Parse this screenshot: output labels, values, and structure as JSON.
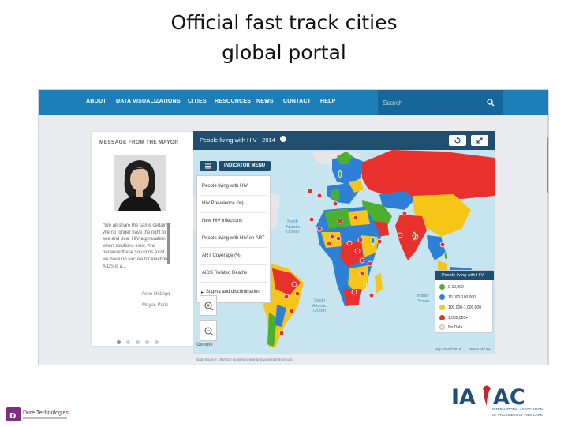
{
  "slide": {
    "title_line1": "Official fast track cities",
    "title_line2": "global portal"
  },
  "nav": {
    "items": [
      "ABOUT",
      "DATA VISUALIZATIONS",
      "CITIES",
      "RESOURCES",
      "NEWS",
      "CONTACT",
      "HELP"
    ],
    "search_placeholder": "Search"
  },
  "mayor": {
    "heading": "MESSAGE FROM THE MAYOR",
    "quote": "\"We all share the same certainty: We no longer have the right to see and bear HIV aggravation when solutions exist. And because these solutions exist, we have no excuse for inaction. AIDS is a...",
    "name": "- Anne Hidalgo",
    "city": "Mayor, Paris"
  },
  "map": {
    "title": "People living with HIV - 2014",
    "menu_label": "INDICATOR MENU",
    "menu_items": [
      "People living with HIV",
      "HIV Prevalence (%)",
      "New HIV Infections",
      "People living with HIV on ART",
      "ART Coverage (%)",
      "AIDS Related Deaths",
      "Stigma and discrimination"
    ],
    "ocean_north_atlantic": "North Atlantic Ocean",
    "ocean_south_atlantic": "South Atlantic Ocean",
    "ocean_indian": "Indian Ocean",
    "google": "Google",
    "map_data": "Map data ©2016",
    "terms": "Terms of Use"
  },
  "legend": {
    "title": "People living with HIV",
    "rows": [
      {
        "label": "0-10,000",
        "color": "#4caf30"
      },
      {
        "label": "10,000-100,000",
        "color": "#2e7fd6"
      },
      {
        "label": "100,000-1,000,000",
        "color": "#f5c518"
      },
      {
        "label": "1,000,000+",
        "color": "#e8302c"
      },
      {
        "label": "No Data",
        "color": "#e6e6e6"
      }
    ]
  },
  "source": "Data Source: UNAIDS aidsinfo online and www.fast-track.org",
  "logos": {
    "iapac_sub": "INTERNATIONAL ASSOCIATION OF PROVIDERS OF AIDS CARE",
    "dure": "Dure Technologies"
  },
  "colors": {
    "nav": "#1d7fb8",
    "map_header": "#1f4e6e",
    "ocean": "#c7e4f1"
  }
}
